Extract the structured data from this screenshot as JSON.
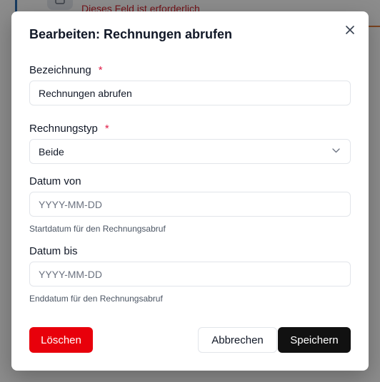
{
  "background": {
    "error_text": "Dieses Feld ist erforderlich"
  },
  "modal": {
    "title": "Bearbeiten: Rechnungen abrufen",
    "close_icon": "close-icon",
    "fields": {
      "bezeichnung": {
        "label": "Bezeichnung",
        "required_marker": "*",
        "value": "Rechnungen abrufen"
      },
      "rechnungstyp": {
        "label": "Rechnungstyp",
        "required_marker": "*",
        "value": "Beide",
        "icon": "chevron-down-icon"
      },
      "datum_von": {
        "label": "Datum von",
        "placeholder": "YYYY-MM-DD",
        "help": "Startdatum für den Rechnungsabruf"
      },
      "datum_bis": {
        "label": "Datum bis",
        "placeholder": "YYYY-MM-DD",
        "help": "Enddatum für den Rechnungsabruf"
      }
    },
    "buttons": {
      "delete": "Löschen",
      "cancel": "Abbrechen",
      "save": "Speichern"
    }
  },
  "colors": {
    "delete_button": "#e8000b",
    "save_button": "#111111",
    "required_marker": "#e11d48",
    "error_text": "#d1242f"
  }
}
